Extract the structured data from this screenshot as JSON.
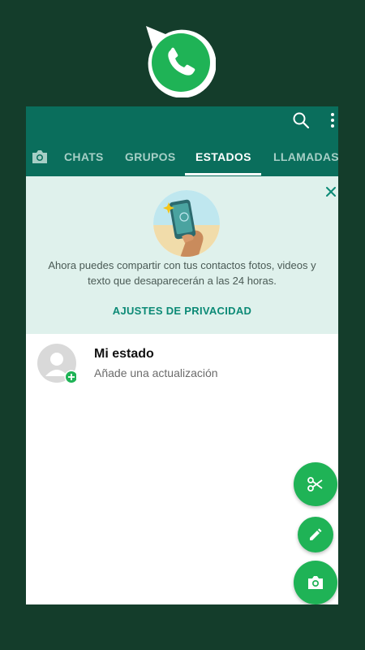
{
  "colors": {
    "background": "#143d2b",
    "header": "#0a6e5c",
    "banner": "#dff1ec",
    "accent": "#1fb356",
    "link": "#0c8a76"
  },
  "toolbar": {
    "search_icon": "search-icon",
    "menu_icon": "more-vert-icon"
  },
  "tabs": {
    "camera_icon": "camera-icon",
    "items": [
      {
        "label": "CHATS"
      },
      {
        "label": "GRUPOS"
      },
      {
        "label": "ESTADOS"
      },
      {
        "label": "LLAMADAS"
      }
    ],
    "active": "ESTADOS"
  },
  "banner": {
    "text": "Ahora puedes compartir con tus contactos fotos, videos y texto que desaparecerán a las 24 horas.",
    "link_label": "AJUSTES DE PRIVACIDAD"
  },
  "my_status": {
    "title": "Mi estado",
    "subtitle": "Añade una actualización"
  },
  "fabs": [
    {
      "icon": "scissors-icon"
    },
    {
      "icon": "pencil-icon"
    },
    {
      "icon": "camera-icon"
    }
  ]
}
